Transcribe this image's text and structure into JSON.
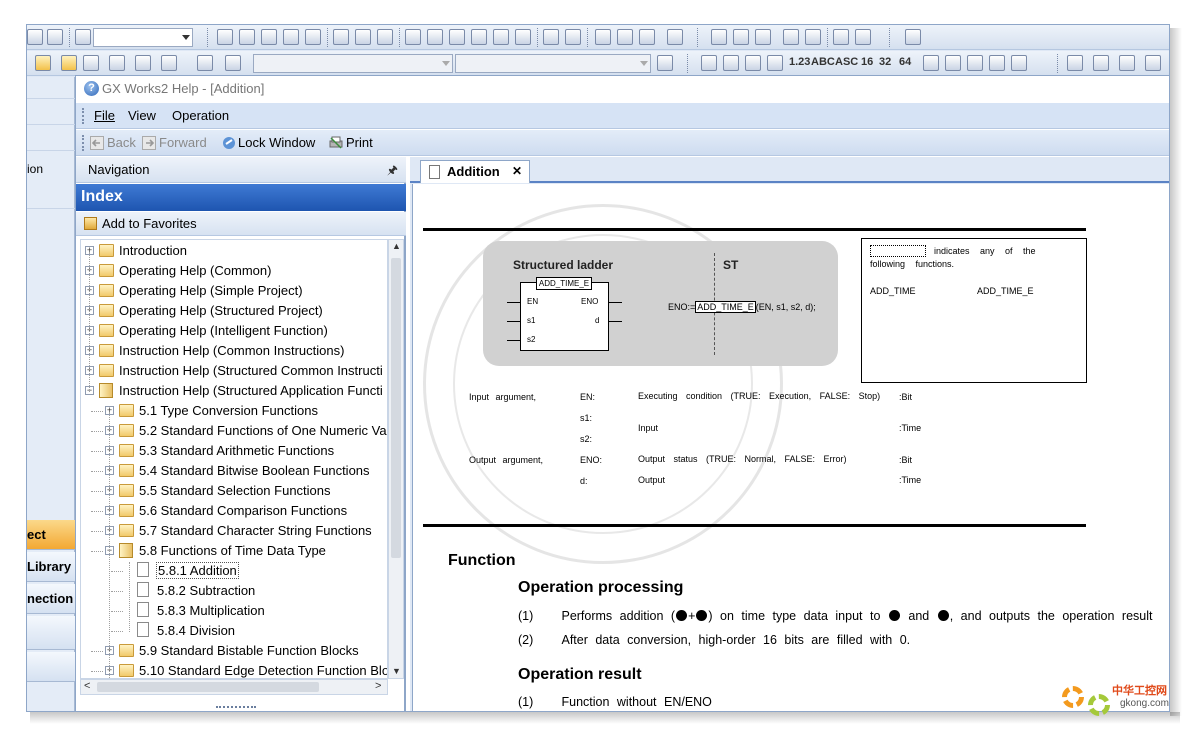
{
  "help_window": {
    "title": "GX Works2 Help - [Addition]"
  },
  "menu": {
    "items": [
      "File",
      "View",
      "Operation"
    ]
  },
  "nav_toolbar": {
    "back": "Back",
    "forward": "Forward",
    "lock_window": "Lock Window",
    "print": "Print"
  },
  "app_toolbar": {
    "texts": [
      "1.23",
      "ABC",
      "ASC",
      "16",
      "32",
      "64"
    ]
  },
  "left_strip": {
    "top_label": "ion",
    "buttons": [
      "ect",
      "Library",
      "nection"
    ]
  },
  "navigation": {
    "header": "Navigation",
    "index_title": "Index",
    "favorites": "Add to Favorites",
    "tree": [
      {
        "level": 0,
        "type": "folder",
        "state": "+",
        "label": "Introduction"
      },
      {
        "level": 0,
        "type": "folder",
        "state": "+",
        "label": "Operating Help (Common)"
      },
      {
        "level": 0,
        "type": "folder",
        "state": "+",
        "label": "Operating Help (Simple Project)"
      },
      {
        "level": 0,
        "type": "folder",
        "state": "+",
        "label": "Operating Help (Structured Project)"
      },
      {
        "level": 0,
        "type": "folder",
        "state": "+",
        "label": "Operating Help (Intelligent Function)"
      },
      {
        "level": 0,
        "type": "folder",
        "state": "+",
        "label": "Instruction Help (Common Instructions)"
      },
      {
        "level": 0,
        "type": "folder",
        "state": "+",
        "label": "Instruction Help (Structured Common Instructi"
      },
      {
        "level": 0,
        "type": "book",
        "state": "-",
        "label": "Instruction Help (Structured Application Functi"
      },
      {
        "level": 1,
        "type": "folder",
        "state": "+",
        "label": "5.1 Type Conversion Functions"
      },
      {
        "level": 1,
        "type": "folder",
        "state": "+",
        "label": "5.2 Standard Functions of One Numeric Va"
      },
      {
        "level": 1,
        "type": "folder",
        "state": "+",
        "label": "5.3 Standard Arithmetic Functions"
      },
      {
        "level": 1,
        "type": "folder",
        "state": "+",
        "label": "5.4 Standard Bitwise Boolean Functions"
      },
      {
        "level": 1,
        "type": "folder",
        "state": "+",
        "label": "5.5 Standard Selection Functions"
      },
      {
        "level": 1,
        "type": "folder",
        "state": "+",
        "label": "5.6 Standard Comparison Functions"
      },
      {
        "level": 1,
        "type": "folder",
        "state": "+",
        "label": "5.7 Standard Character String Functions"
      },
      {
        "level": 1,
        "type": "book",
        "state": "-",
        "label": "5.8 Functions of Time Data Type"
      },
      {
        "level": 2,
        "type": "page",
        "state": "",
        "label": "5.8.1 Addition",
        "selected": true
      },
      {
        "level": 2,
        "type": "page",
        "state": "",
        "label": "5.8.2 Subtraction"
      },
      {
        "level": 2,
        "type": "page",
        "state": "",
        "label": "5.8.3 Multiplication"
      },
      {
        "level": 2,
        "type": "page",
        "state": "",
        "label": "5.8.4 Division"
      },
      {
        "level": 1,
        "type": "folder",
        "state": "+",
        "label": "5.9 Standard Bistable Function Blocks"
      },
      {
        "level": 1,
        "type": "folder",
        "state": "+",
        "label": "5.10 Standard Edge Detection Function Blo"
      },
      {
        "level": 1,
        "type": "folder",
        "state": "+",
        "label": "5.11 Standard Counter Function Blocks"
      }
    ]
  },
  "content": {
    "tab_label": "Addition",
    "diagram": {
      "ladder_title": "Structured ladder",
      "st_title": "ST",
      "function_name": "ADD_TIME_E",
      "pins_left": [
        "EN",
        "s1",
        "s2"
      ],
      "pins_right": [
        "ENO",
        "d"
      ],
      "st_prefix": "ENO:=",
      "st_function": "ADD_TIME_E",
      "st_suffix": "(EN, s1, s2, d);",
      "note_text": "indicates any of the following functions.",
      "note_functions": [
        "ADD_TIME",
        "ADD_TIME_E"
      ]
    },
    "arguments": {
      "input_label": "Input argument,",
      "output_label": "Output argument,",
      "rows": [
        {
          "name": "EN:",
          "desc": "Executing condition (TRUE: Execution, FALSE: Stop)",
          "type": ":Bit"
        },
        {
          "name": "s1:",
          "desc": "",
          "type": ""
        },
        {
          "name": "s2:",
          "desc": "Input",
          "type": ":Time"
        },
        {
          "name": "ENO:",
          "desc": "Output status (TRUE: Normal, FALSE: Error)",
          "type": ":Bit"
        },
        {
          "name": "d:",
          "desc": "Output",
          "type": ":Time"
        }
      ]
    },
    "function_heading": "Function",
    "op_processing_heading": "Operation processing",
    "op_processing": [
      {
        "num": "(1)",
        "text_a": "Performs addition (",
        "text_b": ") on time type data input to",
        "text_c": "and",
        "text_d": ", and outputs the operation result"
      },
      {
        "num": "(2)",
        "text": "After data conversion, high-order 16 bits are filled with 0."
      }
    ],
    "op_result_heading": "Operation result",
    "op_result": [
      {
        "num": "(1)",
        "text": "Function without EN/ENO"
      }
    ]
  },
  "watermark": {
    "line1": "中华工控网",
    "line2": "gkong.com"
  }
}
